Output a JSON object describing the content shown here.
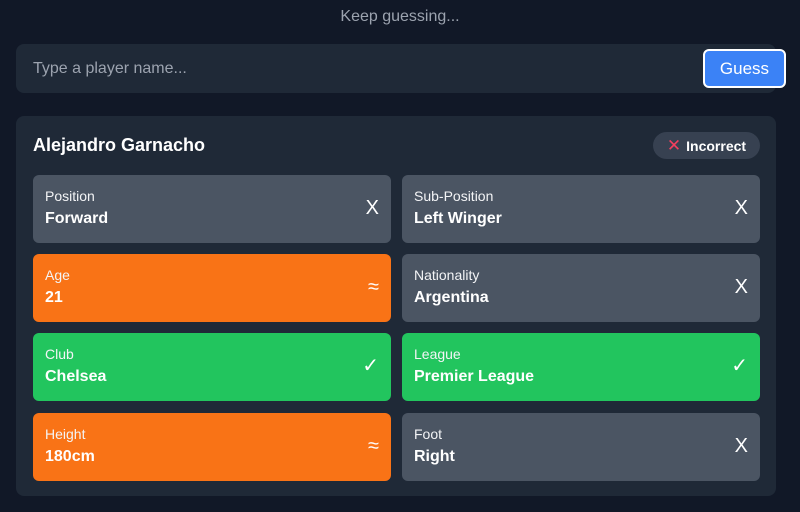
{
  "status_text": "Keep guessing...",
  "search": {
    "placeholder": "Type a player name...",
    "value": "",
    "button_label": "Guess"
  },
  "guess": {
    "player_name": "Alejandro Garnacho",
    "result_icon": "✕",
    "result_label": "Incorrect",
    "attributes": [
      {
        "label": "Position",
        "value": "Forward",
        "status": "wrong",
        "icon": "X"
      },
      {
        "label": "Sub-Position",
        "value": "Left Winger",
        "status": "wrong",
        "icon": "X"
      },
      {
        "label": "Age",
        "value": "21",
        "status": "close",
        "icon": "≈"
      },
      {
        "label": "Nationality",
        "value": "Argentina",
        "status": "wrong",
        "icon": "X"
      },
      {
        "label": "Club",
        "value": "Chelsea",
        "status": "correct",
        "icon": "✓"
      },
      {
        "label": "League",
        "value": "Premier League",
        "status": "correct",
        "icon": "✓"
      },
      {
        "label": "Height",
        "value": "180cm",
        "status": "close",
        "icon": "≈"
      },
      {
        "label": "Foot",
        "value": "Right",
        "status": "wrong",
        "icon": "X"
      }
    ]
  },
  "colors": {
    "background": "#111827",
    "panel": "#1f2937",
    "wrong": "#4b5563",
    "close": "#f97316",
    "correct": "#22c55e",
    "accent": "#3b82f6",
    "incorrect_mark": "#f43f5e"
  }
}
